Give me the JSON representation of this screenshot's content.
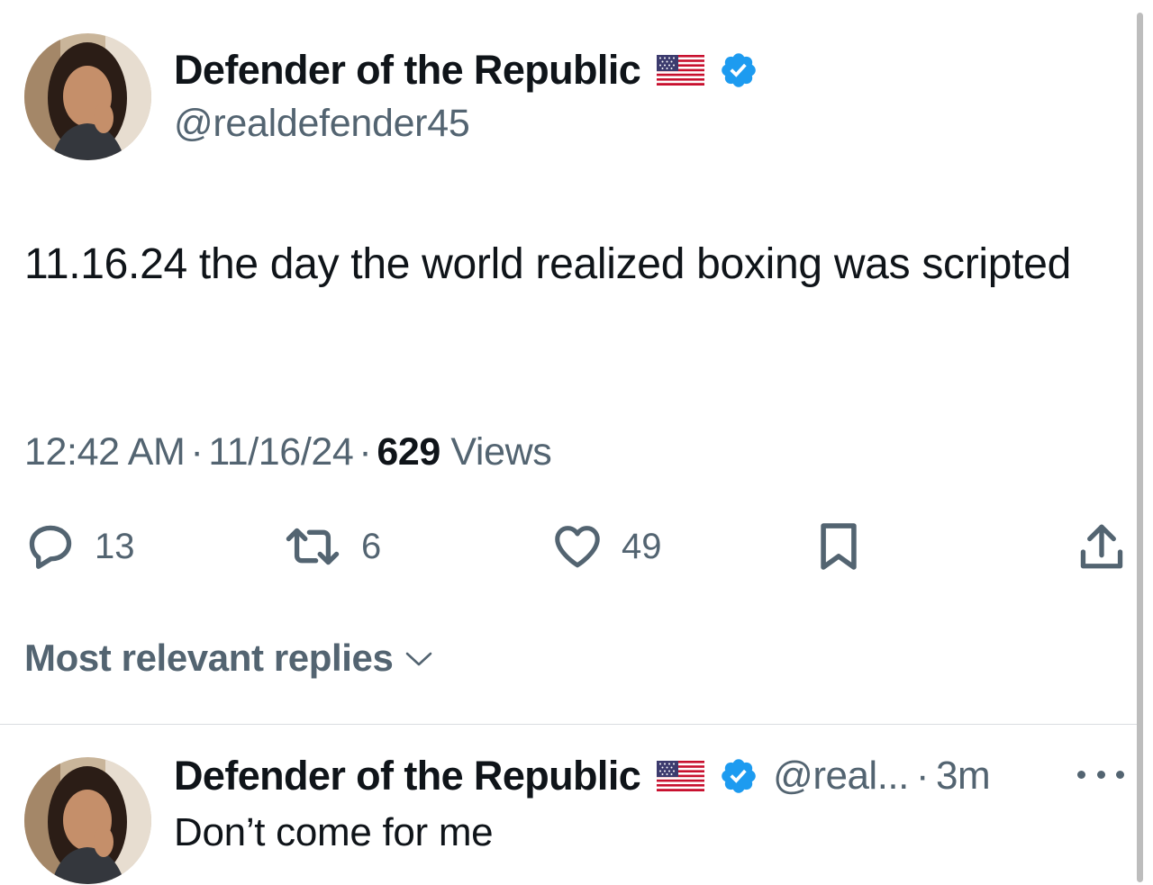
{
  "tweet": {
    "author": {
      "display_name": "Defender of the Republic",
      "handle": "@realdefender45",
      "flag_icon": "us-flag-icon",
      "verified_icon": "verified-badge-icon"
    },
    "text": "11.16.24 the day the world realized boxing was scripted",
    "time": "12:42 AM",
    "date": "11/16/24",
    "separator": "·",
    "views_count": "629",
    "views_label": "Views",
    "actions": {
      "reply_count": "13",
      "retweet_count": "6",
      "like_count": "49"
    }
  },
  "replies_filter": {
    "label": "Most relevant replies"
  },
  "reply": {
    "author": {
      "display_name": "Defender of the Republic",
      "handle_truncated": "@real...",
      "time_ago": "3m"
    },
    "text": "Don’t come for me"
  },
  "colors": {
    "text_primary": "#0f1419",
    "text_secondary": "#536471",
    "verified_blue": "#1d9bf0",
    "divider": "#d9dde1"
  }
}
